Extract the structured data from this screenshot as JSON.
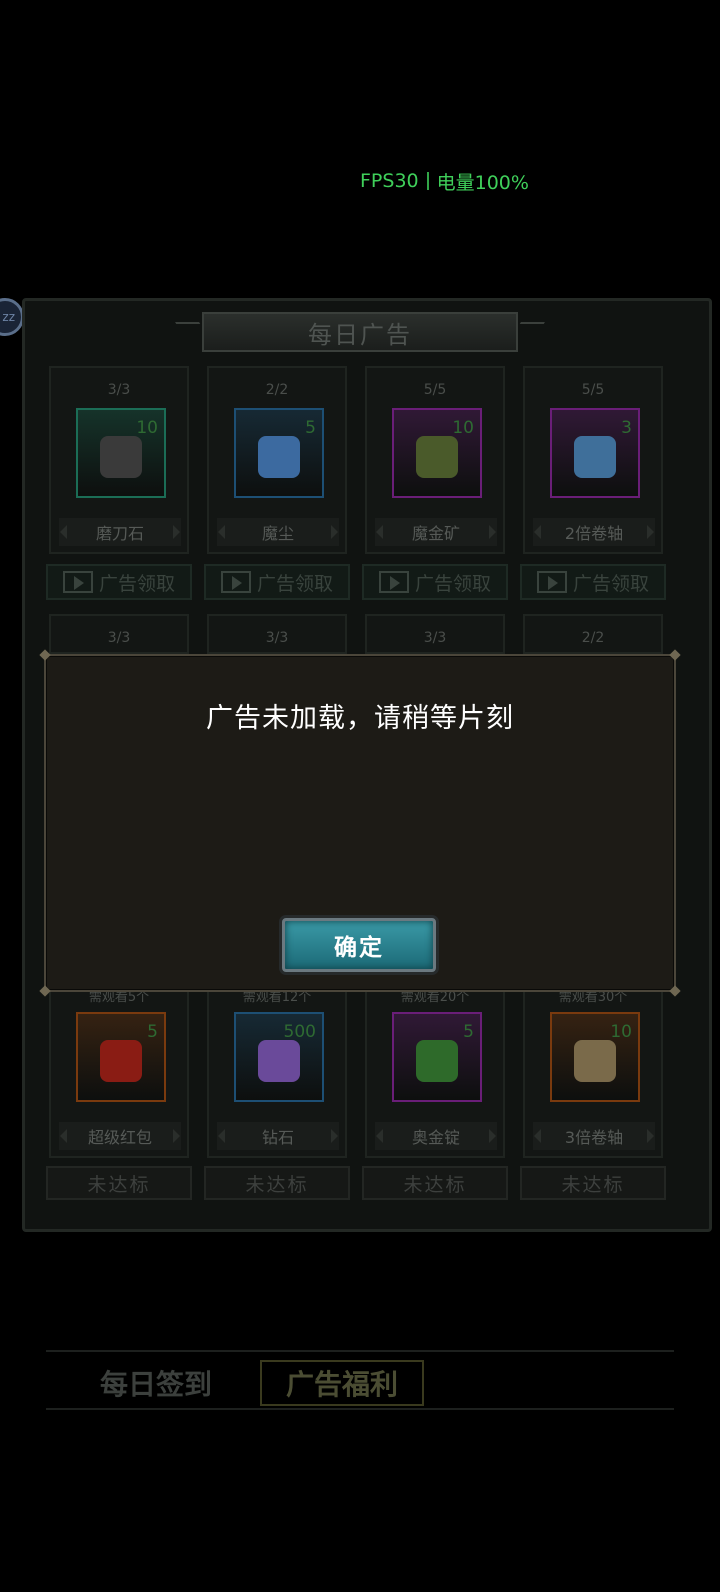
{
  "status": {
    "fps": "FPS30",
    "battery": "电量100%"
  },
  "panel": {
    "title": "每日广告",
    "row1": [
      {
        "count": "3/3",
        "qty": "10",
        "name": "磨刀石",
        "frame": "#1b6d56",
        "item": "#3a3a3a"
      },
      {
        "count": "2/2",
        "qty": "5",
        "name": "魔尘",
        "frame": "#1d4f74",
        "item": "#3c6aa0"
      },
      {
        "count": "5/5",
        "qty": "10",
        "name": "魔金矿",
        "frame": "#6a1e78",
        "item": "#4a5a2a"
      },
      {
        "count": "5/5",
        "qty": "3",
        "name": "2倍卷轴",
        "frame": "#6a1e78",
        "item": "#3f6f9a"
      }
    ],
    "row2_counts": [
      "3/3",
      "3/3",
      "3/3",
      "2/2"
    ],
    "ad_button_label": "广告领取",
    "row3": [
      {
        "need": "需观看5个",
        "qty": "5",
        "name": "超级红包",
        "frame": "#7a3a0e",
        "item": "#8a1c14"
      },
      {
        "need": "需观看12个",
        "qty": "500",
        "name": "钻石",
        "frame": "#1d4f74",
        "item": "#6a4a9a"
      },
      {
        "need": "需观看20个",
        "qty": "5",
        "name": "奥金锭",
        "frame": "#6a1e78",
        "item": "#2e6a2a"
      },
      {
        "need": "需观看30个",
        "qty": "10",
        "name": "3倍卷轴",
        "frame": "#7a3a0e",
        "item": "#7a6a4a"
      }
    ],
    "reach_label": "未达标"
  },
  "tabs": {
    "daily": "每日签到",
    "ad": "广告福利"
  },
  "modal": {
    "message": "广告未加载，请稍等片刻",
    "ok": "确定"
  }
}
